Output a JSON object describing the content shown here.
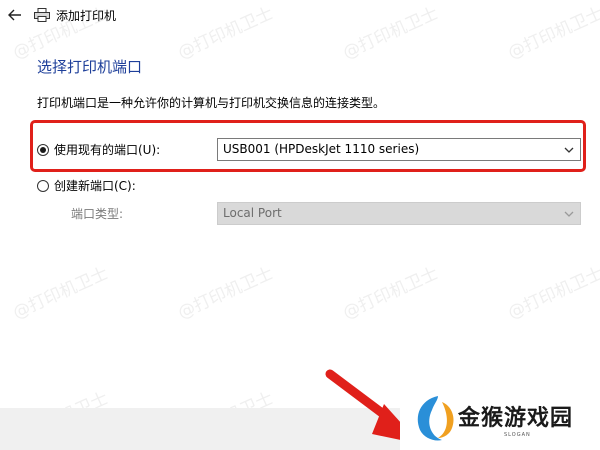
{
  "window": {
    "title": "添加打印机"
  },
  "page": {
    "heading": "选择打印机端口",
    "description": "打印机端口是一种允许你的计算机与打印机交换信息的连接类型。"
  },
  "existing_port": {
    "label": "使用现有的端口(U):",
    "selected": true,
    "value": "USB001 (HPDeskJet 1110 series)"
  },
  "new_port": {
    "label": "创建新端口(C):",
    "selected": false,
    "type_label": "端口类型:",
    "type_value": "Local Port"
  },
  "watermark": {
    "text": "@打印机卫士"
  },
  "logo": {
    "text": "金猴游戏园",
    "slogan": "SLOGAN"
  },
  "colors": {
    "heading": "#1e3f9a",
    "highlight": "#e0201a"
  }
}
